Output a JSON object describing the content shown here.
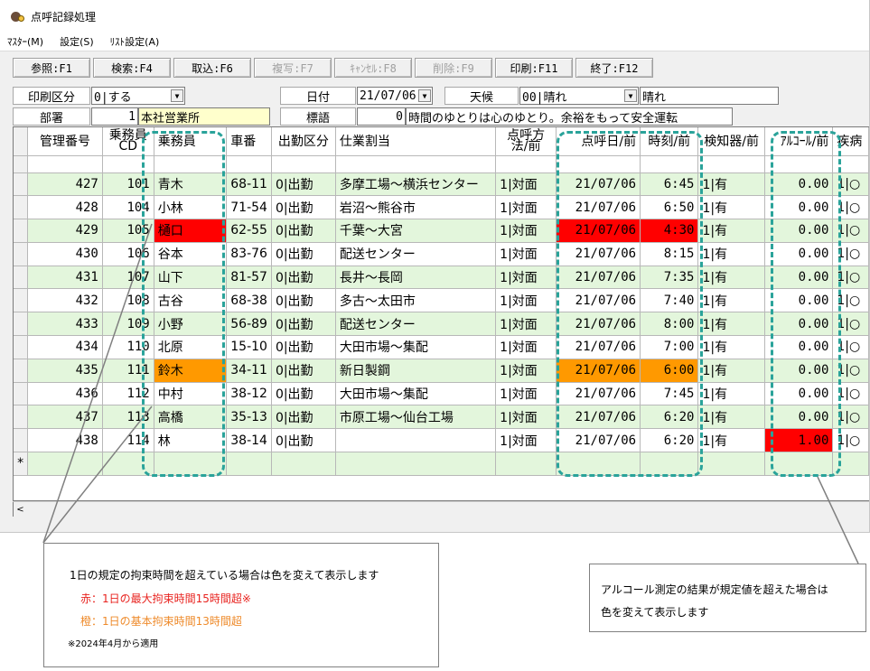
{
  "window": {
    "title": "点呼記録処理",
    "menu": [
      "ﾏｽﾀｰ(M)",
      "設定(S)",
      "ﾘｽﾄ設定(A)"
    ]
  },
  "toolbar": [
    {
      "label": "参照:F1",
      "enabled": true
    },
    {
      "label": "検索:F4",
      "enabled": true
    },
    {
      "label": "取込:F6",
      "enabled": true
    },
    {
      "label": "複写:F7",
      "enabled": false
    },
    {
      "label": "ｷｬﾝｾﾙ:F8",
      "enabled": false
    },
    {
      "label": "削除:F9",
      "enabled": false
    },
    {
      "label": "印刷:F11",
      "enabled": true
    },
    {
      "label": "終了:F12",
      "enabled": true
    }
  ],
  "form": {
    "print_label": "印刷区分",
    "print_value": "0|する",
    "date_label": "日付",
    "date_value": "21/07/06",
    "weather_label": "天候",
    "weather_code": "00|晴れ",
    "weather_text": "晴れ",
    "dept_label": "部署",
    "dept_code": "1",
    "dept_name": "本社営業所",
    "motto_label": "標語",
    "motto_code": "0",
    "motto_text": "時間のゆとりは心のゆとり。余裕をもって安全運転"
  },
  "columns": {
    "mgmt": "管理番号",
    "crew_cd_1": "乗務員",
    "crew_cd_2": "CD",
    "crew": "乗務員",
    "car": "車番",
    "attend": "出勤区分",
    "job": "仕業割当",
    "method_1": "点呼方",
    "method_2": "法/前",
    "date": "点呼日/前",
    "time": "時刻/前",
    "detector": "検知器/前",
    "alcohol": "ｱﾙｺｰﾙ/前",
    "illness": "疾病"
  },
  "rows": [
    {
      "mgmt": "427",
      "cd": "101",
      "crew": "青木",
      "car": "68-11",
      "attend": "0|出勤",
      "job": "多摩工場～横浜センター",
      "method": "1|対面",
      "date": "21/07/06",
      "time": "6:45",
      "detector": "1|有",
      "alcohol": "0.00",
      "illness": "1|○",
      "hl": ""
    },
    {
      "mgmt": "428",
      "cd": "104",
      "crew": "小林",
      "car": "71-54",
      "attend": "0|出勤",
      "job": "岩沼～熊谷市",
      "method": "1|対面",
      "date": "21/07/06",
      "time": "6:50",
      "detector": "1|有",
      "alcohol": "0.00",
      "illness": "1|○",
      "hl": ""
    },
    {
      "mgmt": "429",
      "cd": "105",
      "crew": "樋口",
      "car": "62-55",
      "attend": "0|出勤",
      "job": "千葉～大宮",
      "method": "1|対面",
      "date": "21/07/06",
      "time": "4:30",
      "detector": "1|有",
      "alcohol": "0.00",
      "illness": "1|○",
      "hl": "red"
    },
    {
      "mgmt": "430",
      "cd": "106",
      "crew": "谷本",
      "car": "83-76",
      "attend": "0|出勤",
      "job": "配送センター",
      "method": "1|対面",
      "date": "21/07/06",
      "time": "8:15",
      "detector": "1|有",
      "alcohol": "0.00",
      "illness": "1|○",
      "hl": ""
    },
    {
      "mgmt": "431",
      "cd": "107",
      "crew": "山下",
      "car": "81-57",
      "attend": "0|出勤",
      "job": "長井～長岡",
      "method": "1|対面",
      "date": "21/07/06",
      "time": "7:35",
      "detector": "1|有",
      "alcohol": "0.00",
      "illness": "1|○",
      "hl": ""
    },
    {
      "mgmt": "432",
      "cd": "108",
      "crew": "古谷",
      "car": "68-38",
      "attend": "0|出勤",
      "job": "多古～太田市",
      "method": "1|対面",
      "date": "21/07/06",
      "time": "7:40",
      "detector": "1|有",
      "alcohol": "0.00",
      "illness": "1|○",
      "hl": ""
    },
    {
      "mgmt": "433",
      "cd": "109",
      "crew": "小野",
      "car": "56-89",
      "attend": "0|出勤",
      "job": "配送センター",
      "method": "1|対面",
      "date": "21/07/06",
      "time": "8:00",
      "detector": "1|有",
      "alcohol": "0.00",
      "illness": "1|○",
      "hl": ""
    },
    {
      "mgmt": "434",
      "cd": "110",
      "crew": "北原",
      "car": "15-10",
      "attend": "0|出勤",
      "job": "大田市場～集配",
      "method": "1|対面",
      "date": "21/07/06",
      "time": "7:00",
      "detector": "1|有",
      "alcohol": "0.00",
      "illness": "1|○",
      "hl": ""
    },
    {
      "mgmt": "435",
      "cd": "111",
      "crew": "鈴木",
      "car": "34-11",
      "attend": "0|出勤",
      "job": "新日製鋼",
      "method": "1|対面",
      "date": "21/07/06",
      "time": "6:00",
      "detector": "1|有",
      "alcohol": "0.00",
      "illness": "1|○",
      "hl": "orange"
    },
    {
      "mgmt": "436",
      "cd": "112",
      "crew": "中村",
      "car": "38-12",
      "attend": "0|出勤",
      "job": "大田市場～集配",
      "method": "1|対面",
      "date": "21/07/06",
      "time": "7:45",
      "detector": "1|有",
      "alcohol": "0.00",
      "illness": "1|○",
      "hl": ""
    },
    {
      "mgmt": "437",
      "cd": "113",
      "crew": "高橋",
      "car": "35-13",
      "attend": "0|出勤",
      "job": "市原工場～仙台工場",
      "method": "1|対面",
      "date": "21/07/06",
      "time": "6:20",
      "detector": "1|有",
      "alcohol": "0.00",
      "illness": "1|○",
      "hl": ""
    },
    {
      "mgmt": "438",
      "cd": "114",
      "crew": "林",
      "car": "38-14",
      "attend": "0|出勤",
      "job": "",
      "method": "1|対面",
      "date": "21/07/06",
      "time": "6:20",
      "detector": "1|有",
      "alcohol": "1.00",
      "illness": "1|○",
      "hl": "alcohol"
    }
  ],
  "new_row_marker": "*",
  "highlight_colors": {
    "red": "#ff0000",
    "orange": "#ff9900",
    "dash": "#2aa39a",
    "row_green": "#e3f6dc"
  },
  "callout_left": {
    "line1": "1日の規定の拘束時間を超えている場合は色を変えて表示します",
    "line2": "赤：1日の最大拘束時間15時間超※",
    "line3": "橙：1日の基本拘束時間13時間超",
    "line4": "※2024年4月から適用"
  },
  "callout_right": {
    "line1": "アルコール測定の結果が規定値を超えた場合は",
    "line2": "色を変えて表示します"
  }
}
